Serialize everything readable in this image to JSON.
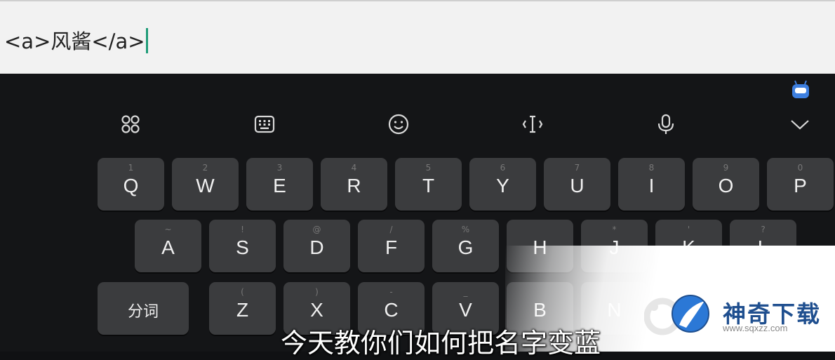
{
  "input": {
    "text": "<a>风酱</a>"
  },
  "toolbar": {
    "icons": [
      "apps-grid-icon",
      "keyboard-icon",
      "emoji-icon",
      "text-cursor-icon",
      "microphone-icon",
      "chevron-down-icon"
    ]
  },
  "keyboard": {
    "row1": [
      {
        "hint": "1",
        "label": "Q"
      },
      {
        "hint": "2",
        "label": "W"
      },
      {
        "hint": "3",
        "label": "E"
      },
      {
        "hint": "4",
        "label": "R"
      },
      {
        "hint": "5",
        "label": "T"
      },
      {
        "hint": "6",
        "label": "Y"
      },
      {
        "hint": "7",
        "label": "U"
      },
      {
        "hint": "8",
        "label": "I"
      },
      {
        "hint": "9",
        "label": "O"
      },
      {
        "hint": "0",
        "label": "P"
      }
    ],
    "row2": [
      {
        "hint": "~",
        "label": "A"
      },
      {
        "hint": "!",
        "label": "S"
      },
      {
        "hint": "@",
        "label": "D"
      },
      {
        "hint": "/",
        "label": "F"
      },
      {
        "hint": "%",
        "label": "G"
      },
      {
        "hint": "",
        "label": "H"
      },
      {
        "hint": "*",
        "label": "J"
      },
      {
        "hint": "'",
        "label": "K"
      },
      {
        "hint": "?",
        "label": "L"
      }
    ],
    "row3_fn": "分词",
    "row3": [
      {
        "hint": "(",
        "label": "Z"
      },
      {
        "hint": ")",
        "label": "X"
      },
      {
        "hint": "-",
        "label": "C"
      },
      {
        "hint": "_",
        "label": "V"
      },
      {
        "hint": "",
        "label": "B"
      },
      {
        "hint": "",
        "label": "N"
      }
    ]
  },
  "watermark": {
    "name": "神奇下载",
    "url": "www.sqxzz.com"
  },
  "subtitle": "今天教你们如何把名字变蓝",
  "colors": {
    "cursor": "#1f9c78",
    "key_bg": "#3b3c3e",
    "keyboard_bg": "#141517",
    "watermark_blue": "#1f4f8f"
  }
}
